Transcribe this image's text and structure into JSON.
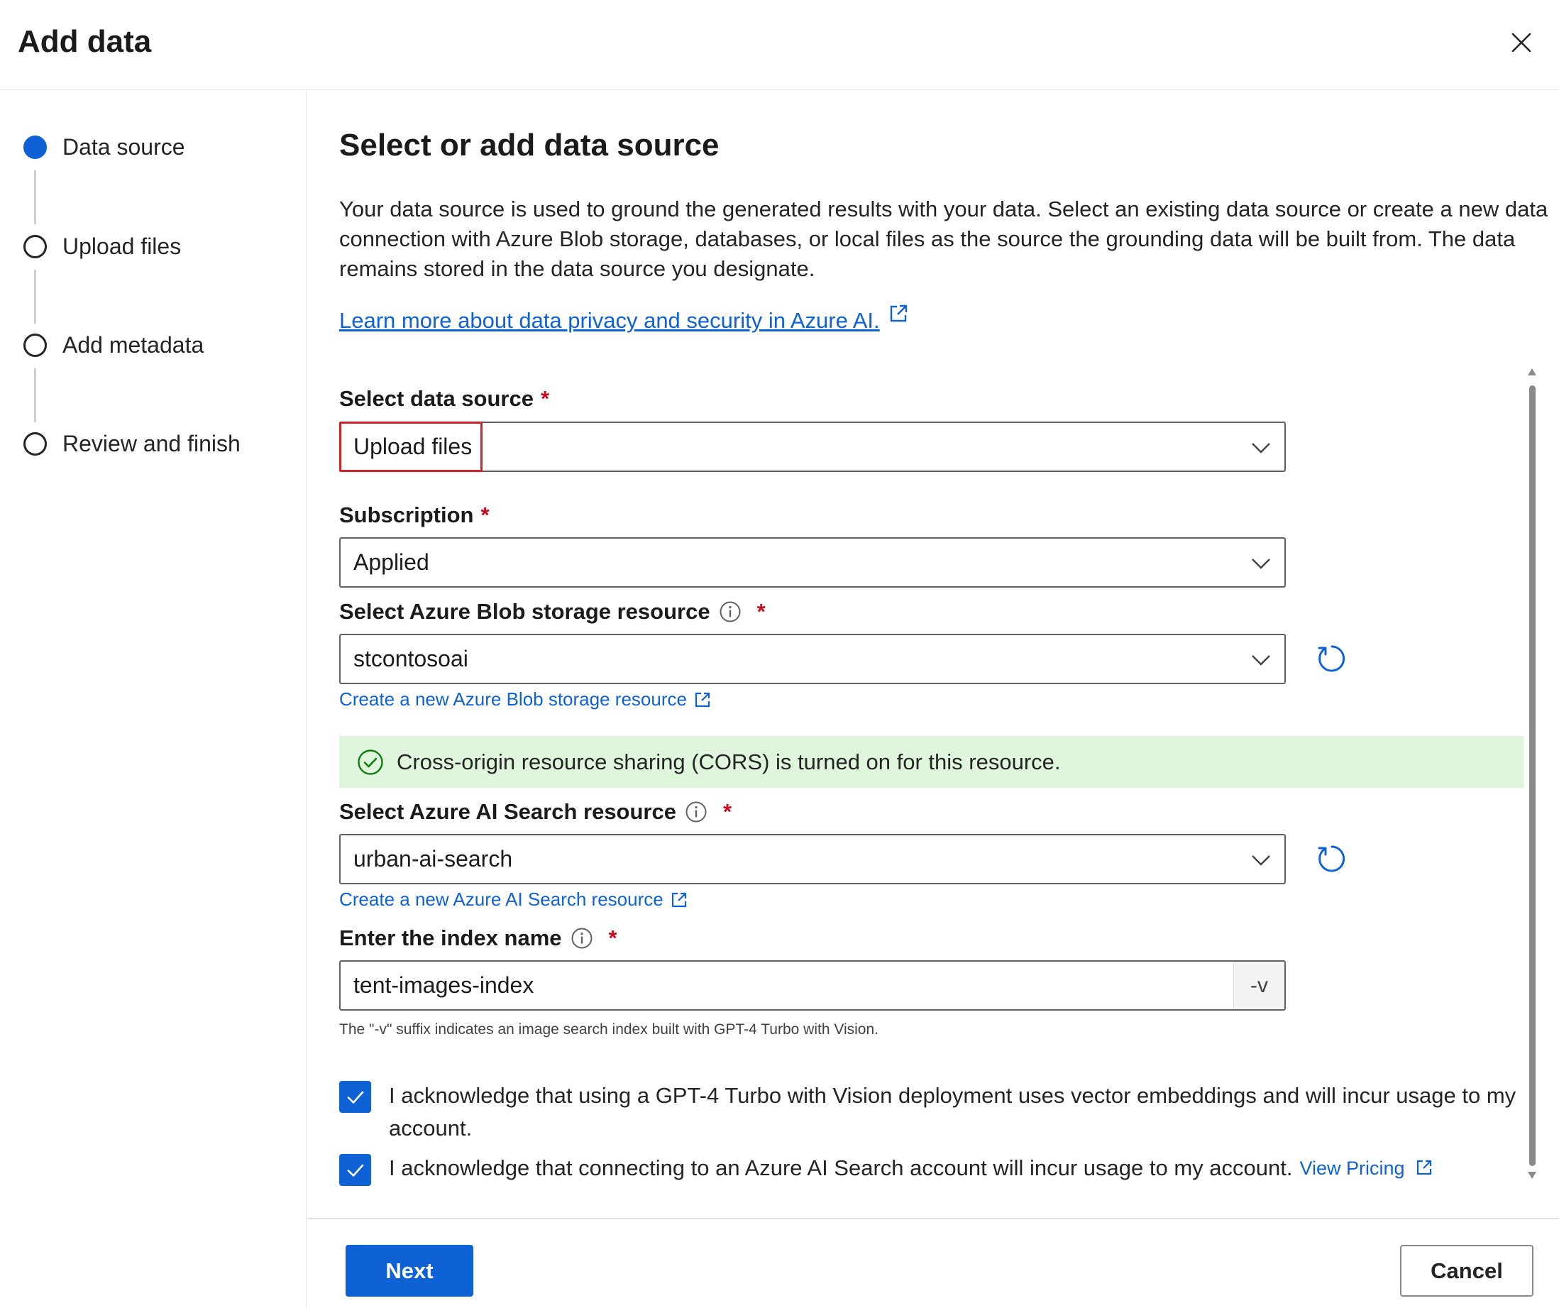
{
  "dialog": {
    "title": "Add data",
    "close_icon": "close-icon"
  },
  "steps": [
    {
      "label": "Data source",
      "state": "active"
    },
    {
      "label": "Upload files",
      "state": "pending"
    },
    {
      "label": "Add metadata",
      "state": "pending"
    },
    {
      "label": "Review and finish",
      "state": "pending"
    }
  ],
  "main": {
    "title": "Select or add data source",
    "description": "Your data source is used to ground the generated results with your data. Select an existing data source or create a new data connection with Azure Blob storage, databases, or local files as the source the grounding data will be built from. The data remains stored in the data source you designate.",
    "learn_more_link": "Learn more about data privacy and security in Azure AI."
  },
  "form": {
    "data_source": {
      "label": "Select data source",
      "required_mark": "*",
      "value": "Upload files"
    },
    "subscription": {
      "label": "Subscription",
      "required_mark": "*",
      "value": "Applied"
    },
    "blob_storage": {
      "label": "Select Azure Blob storage resource",
      "required_mark": "*",
      "value": "stcontosoai",
      "create_link": "Create a new Azure Blob storage resource"
    },
    "cors_status": {
      "text": "Cross-origin resource sharing (CORS) is turned on for this resource.",
      "color": "#dff6dd"
    },
    "ai_search": {
      "label": "Select Azure AI Search resource",
      "required_mark": "*",
      "value": "urban-ai-search",
      "create_link": "Create a new Azure AI Search resource"
    },
    "index_name": {
      "label": "Enter the index name",
      "required_mark": "*",
      "value": "tent-images-index",
      "suffix": "-v",
      "hint": "The \"-v\" suffix indicates an image search index built with GPT-4 Turbo with Vision."
    },
    "ack_vision": {
      "checked": true,
      "text": "I acknowledge that using a GPT-4 Turbo with Vision deployment uses vector embeddings and will incur usage to my account."
    },
    "ack_search": {
      "checked": true,
      "text": "I acknowledge that connecting to an Azure AI Search account will incur usage to my account.",
      "link": "View Pricing"
    }
  },
  "footer": {
    "next_label": "Next",
    "cancel_label": "Cancel"
  },
  "colors": {
    "accent": "#0f62d6",
    "required": "#c50f1f",
    "highlight": "#d1212a",
    "success_bg": "#dff6dd"
  }
}
